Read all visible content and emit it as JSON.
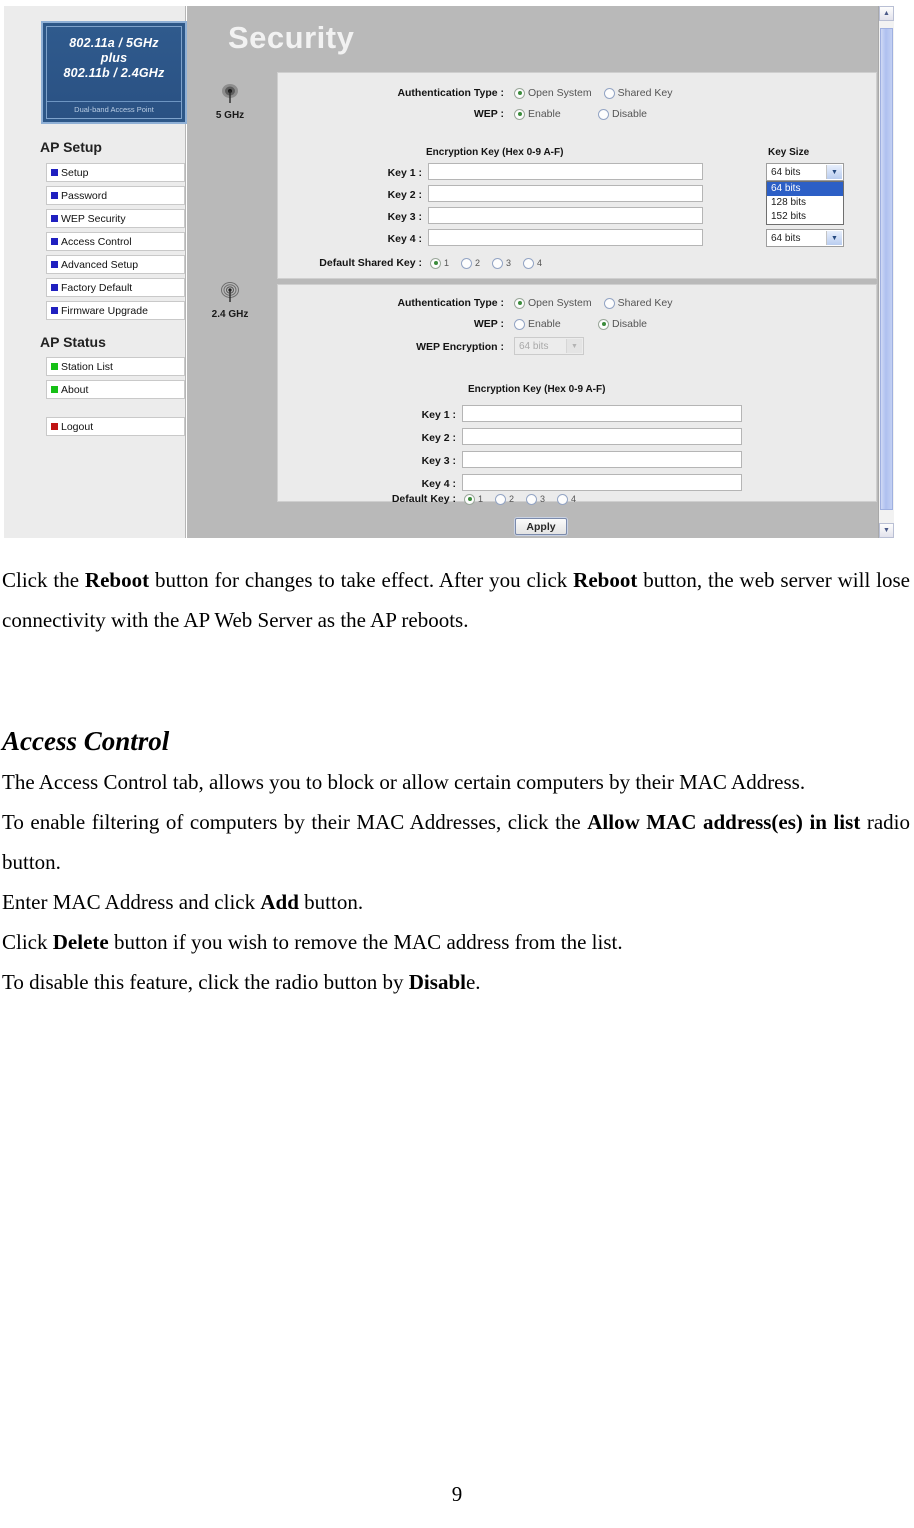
{
  "screenshot": {
    "page_title": "Security",
    "logo": {
      "line1": "802.11a / 5GHz",
      "line2": "plus",
      "line3": "802.11b / 2.4GHz",
      "subtitle": "Dual-band Access Point"
    },
    "sidebar": {
      "section1_title": "AP Setup",
      "section1_items": [
        {
          "label": "Setup",
          "bullet": "blue"
        },
        {
          "label": "Password",
          "bullet": "blue"
        },
        {
          "label": "WEP Security",
          "bullet": "blue"
        },
        {
          "label": "Access Control",
          "bullet": "blue"
        },
        {
          "label": "Advanced Setup",
          "bullet": "blue"
        },
        {
          "label": "Factory Default",
          "bullet": "blue"
        },
        {
          "label": "Firmware Upgrade",
          "bullet": "blue"
        }
      ],
      "section2_title": "AP Status",
      "section2_items": [
        {
          "label": "Station List",
          "bullet": "green"
        },
        {
          "label": "About",
          "bullet": "green"
        }
      ],
      "logout": {
        "label": "Logout",
        "bullet": "red"
      }
    },
    "band_5ghz": {
      "band_label": "5 GHz",
      "auth_label": "Authentication Type :",
      "auth_options": [
        "Open System",
        "Shared Key"
      ],
      "auth_selected": "Open System",
      "wep_label": "WEP :",
      "wep_options": [
        "Enable",
        "Disable"
      ],
      "wep_selected": "Enable",
      "enc_header": "Encryption Key (Hex 0-9 A-F)",
      "keysize_header": "Key Size",
      "keys": [
        {
          "label": "Key 1 :",
          "value": "",
          "keysize": "64 bits"
        },
        {
          "label": "Key 2 :",
          "value": "",
          "keysize": "64 bits"
        },
        {
          "label": "Key 3 :",
          "value": "",
          "keysize": "64 bits"
        },
        {
          "label": "Key 4 :",
          "value": "",
          "keysize": "64 bits"
        }
      ],
      "open_dropdown": {
        "options": [
          "64 bits",
          "128 bits",
          "152 bits"
        ],
        "highlighted": "64 bits"
      },
      "default_key_label": "Default Shared Key :",
      "default_key_options": [
        "1",
        "2",
        "3",
        "4"
      ],
      "default_key_selected": "1"
    },
    "band_24ghz": {
      "band_label": "2.4 GHz",
      "auth_label": "Authentication Type :",
      "auth_options": [
        "Open System",
        "Shared Key"
      ],
      "auth_selected": "Open System",
      "wep_label": "WEP :",
      "wep_options": [
        "Enable",
        "Disable"
      ],
      "wep_selected": "Disable",
      "wep_enc_label": "WEP Encryption :",
      "wep_enc_value": "64 bits",
      "enc_header": "Encryption Key (Hex 0-9 A-F)",
      "keys": [
        {
          "label": "Key 1 :",
          "value": ""
        },
        {
          "label": "Key 2 :",
          "value": ""
        },
        {
          "label": "Key 3 :",
          "value": ""
        },
        {
          "label": "Key 4 :",
          "value": ""
        }
      ],
      "default_key_label": "Default Key :",
      "default_key_options": [
        "1",
        "2",
        "3",
        "4"
      ],
      "default_key_selected": "1"
    },
    "apply_button": "Apply",
    "scrollbar": {
      "up": "▲",
      "down": "▼"
    }
  },
  "document": {
    "para_reboot": {
      "t1": "Click the ",
      "b1": "Reboot",
      "t2": " button for changes to take effect. After you click ",
      "b2": "Reboot",
      "t3": " button, the web server will lose connectivity with the AP Web Server as the AP reboots."
    },
    "section_heading": "Access Control",
    "para_intro": "The Access Control tab, allows you to block or allow certain computers by their MAC Address.",
    "para_enable": {
      "t1": "To enable filtering of computers by their MAC Addresses, click the ",
      "b1": "Allow MAC address(es) in list",
      "t2": " radio button."
    },
    "para_add": {
      "t1": "Enter MAC Address and click ",
      "b1": "Add",
      "t2": " button."
    },
    "para_delete": {
      "t1": "Click ",
      "b1": "Delete",
      "t2": " button if you wish to remove the MAC address from the list."
    },
    "para_disable": {
      "t1": "To disable this feature, click the radio button by ",
      "b1": "Disabl",
      "t2": "e."
    },
    "page_number": "9"
  }
}
